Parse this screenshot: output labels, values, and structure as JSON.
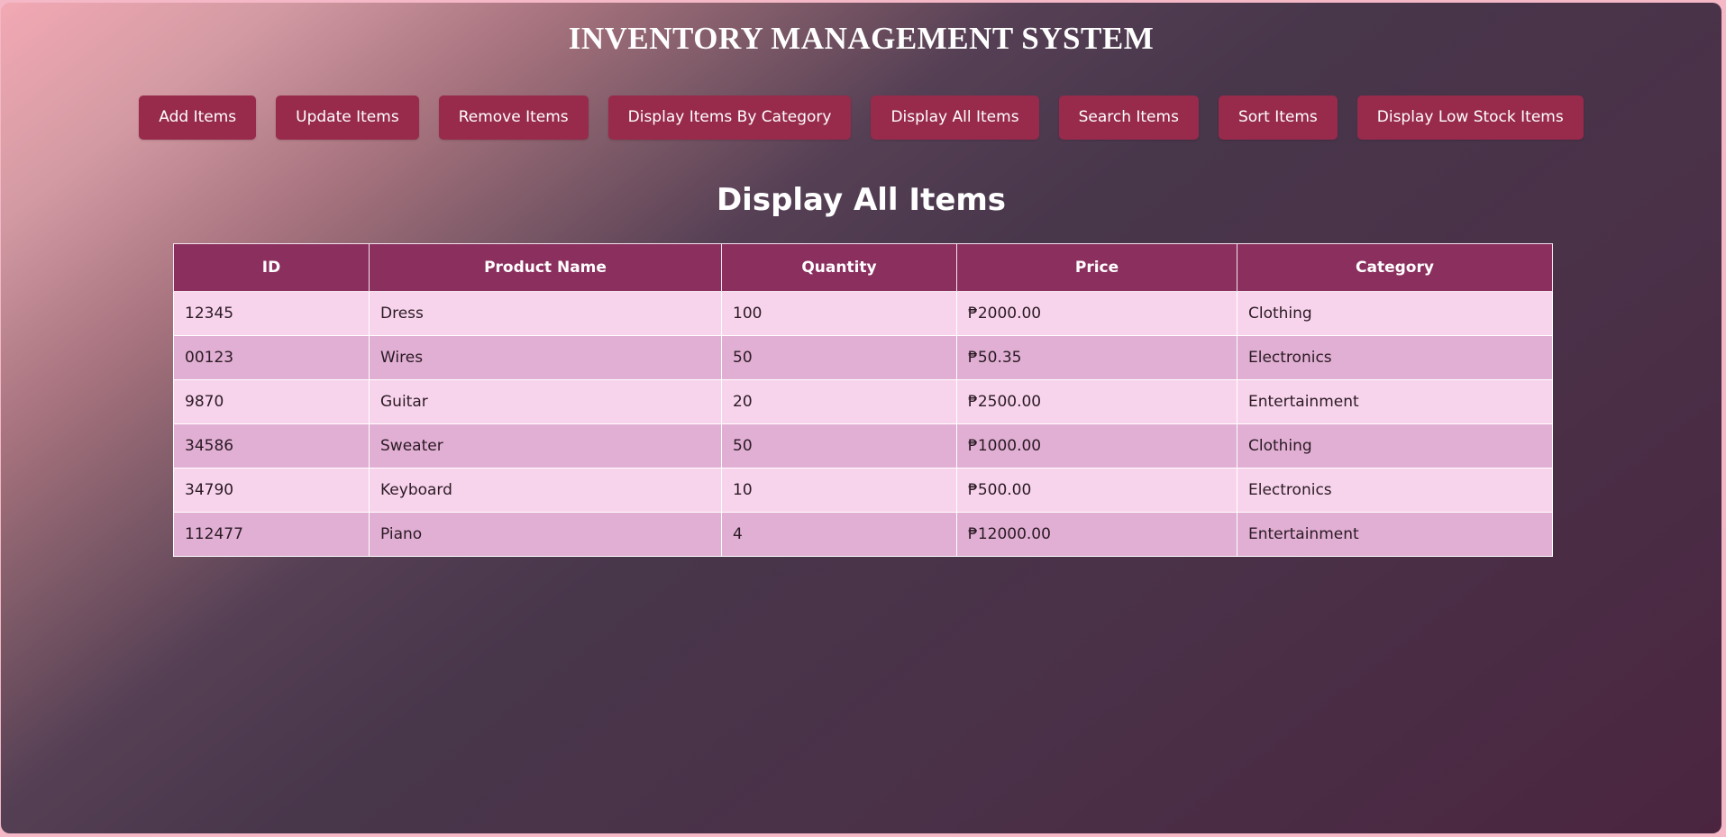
{
  "app": {
    "title": "INVENTORY MANAGEMENT SYSTEM"
  },
  "nav": {
    "buttons": [
      {
        "label": "Add Items"
      },
      {
        "label": "Update Items"
      },
      {
        "label": "Remove Items"
      },
      {
        "label": "Display Items By Category"
      },
      {
        "label": "Display All Items"
      },
      {
        "label": "Search Items"
      },
      {
        "label": "Sort Items"
      },
      {
        "label": "Display Low Stock Items"
      }
    ]
  },
  "section": {
    "title": "Display All Items"
  },
  "table": {
    "headers": [
      "ID",
      "Product Name",
      "Quantity",
      "Price",
      "Category"
    ],
    "rows": [
      [
        "12345",
        "Dress",
        "100",
        "₱2000.00",
        "Clothing"
      ],
      [
        "00123",
        "Wires",
        "50",
        "₱50.35",
        "Electronics"
      ],
      [
        "9870",
        "Guitar",
        "20",
        "₱2500.00",
        "Entertainment"
      ],
      [
        "34586",
        "Sweater",
        "50",
        "₱1000.00",
        "Clothing"
      ],
      [
        "34790",
        "Keyboard",
        "10",
        "₱500.00",
        "Electronics"
      ],
      [
        "112477",
        "Piano",
        "4",
        "₱12000.00",
        "Entertainment"
      ]
    ]
  },
  "colors": {
    "button_bg": "#982a4b",
    "header_bg": "#8b2f5e",
    "row_light": "#f8d4ec",
    "row_dark": "#e1afd3"
  }
}
